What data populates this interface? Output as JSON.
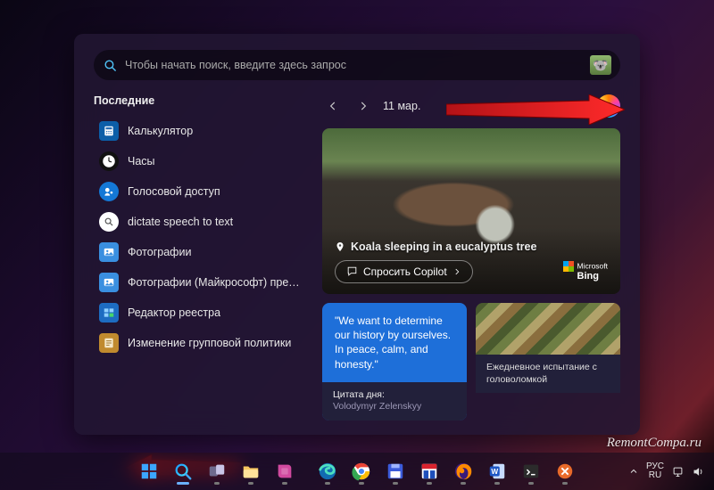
{
  "search": {
    "placeholder": "Чтобы начать поиск, введите здесь запрос"
  },
  "sections": {
    "recent_title": "Последние"
  },
  "recent": [
    {
      "label": "Калькулятор",
      "icon": "calculator",
      "bg": "#0c5ea8"
    },
    {
      "label": "Часы",
      "icon": "clock",
      "bg": "#2b2b2b"
    },
    {
      "label": "Голосовой доступ",
      "icon": "voice",
      "bg": "#1478d6"
    },
    {
      "label": "dictate speech to text",
      "icon": "search",
      "bg": "#ffffff"
    },
    {
      "label": "Фотографии",
      "icon": "photos",
      "bg": "#3a8fe0"
    },
    {
      "label": "Фотографии (Майкрософт) прежних…",
      "icon": "photos",
      "bg": "#3a8fe0"
    },
    {
      "label": "Редактор реестра",
      "icon": "regedit",
      "bg": "#1d6cc1"
    },
    {
      "label": "Изменение групповой политики",
      "icon": "gpedit",
      "bg": "#c08a2e"
    }
  ],
  "date_nav": {
    "label": "11 мар."
  },
  "hero": {
    "caption": "Koala sleeping in a eucalyptus tree",
    "ask_label": "Спросить Copilot",
    "brand_top": "Microsoft",
    "brand_bottom": "Bing"
  },
  "quote": {
    "text": "\"We want to determine our history by ourselves. In peace, calm, and honesty.\"",
    "footer_title": "Цитата дня:",
    "footer_sub": "Volodymyr Zelenskyy"
  },
  "puzzle": {
    "footer": "Ежедневное испытание с головоломкой"
  },
  "taskbar": {
    "lang_top": "РУС",
    "lang_bottom": "RU"
  },
  "watermark": "RemontCompa.ru"
}
